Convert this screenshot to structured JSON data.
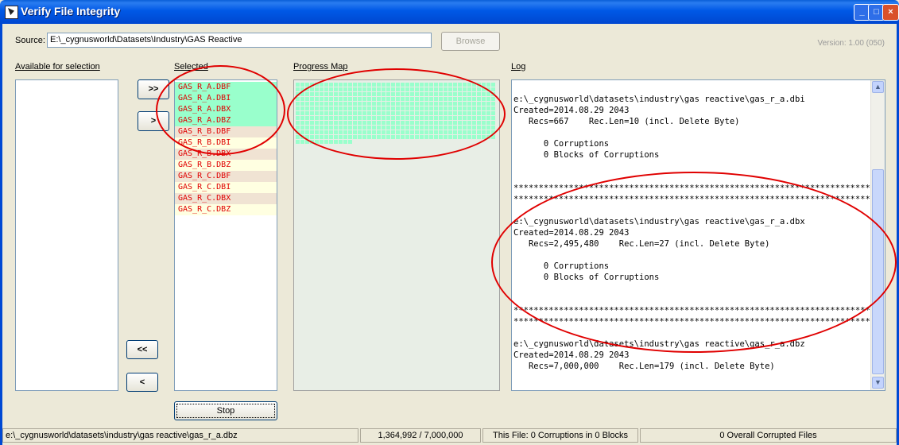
{
  "window": {
    "title": "Verify File Integrity",
    "controls": [
      "_",
      "□",
      "×"
    ]
  },
  "source": {
    "label": "Source:",
    "value": "E:\\_cygnusworld\\Datasets\\Industry\\GAS Reactive",
    "browse_label": "Browse",
    "version": "Version: 1.00 (050)"
  },
  "sections": {
    "available": "Available for selection",
    "selected": "Selected",
    "progress": "Progress Map",
    "log": "Log"
  },
  "buttons": {
    "add_all": ">>",
    "add_one": ">",
    "remove_all": "<<",
    "remove_one": "<",
    "stop": "Stop"
  },
  "selected_files": [
    {
      "name": "GAS_R_A.DBF",
      "status": "done"
    },
    {
      "name": "GAS_R_A.DBI",
      "status": "done"
    },
    {
      "name": "GAS_R_A.DBX",
      "status": "done"
    },
    {
      "name": "GAS_R_A.DBZ",
      "status": "done"
    },
    {
      "name": "GAS_R_B.DBF",
      "status": "pending"
    },
    {
      "name": "GAS_R_B.DBI",
      "status": "pending"
    },
    {
      "name": "GAS_R_B.DBX",
      "status": "pending"
    },
    {
      "name": "GAS_R_B.DBZ",
      "status": "pending"
    },
    {
      "name": "GAS_R_C.DBF",
      "status": "pending"
    },
    {
      "name": "GAS_R_C.DBI",
      "status": "pending"
    },
    {
      "name": "GAS_R_C.DBX",
      "status": "pending"
    },
    {
      "name": "GAS_R_C.DBZ",
      "status": "pending"
    }
  ],
  "progress_map": {
    "fraction": 0.195,
    "fill_color": "#99ffcc",
    "background": "#e8eee6"
  },
  "log_lines": [
    "e:\\_cygnusworld\\datasets\\industry\\gas reactive\\gas_r_a.dbi",
    "Created=2014.08.29 2043",
    "   Recs=667    Rec.Len=10 (incl. Delete Byte)",
    "",
    "      0 Corruptions",
    "      0 Blocks of Corruptions",
    "",
    "",
    "*******************************************************************************",
    "*******************************************************************************",
    "",
    "e:\\_cygnusworld\\datasets\\industry\\gas reactive\\gas_r_a.dbx",
    "Created=2014.08.29 2043",
    "   Recs=2,495,480    Rec.Len=27 (incl. Delete Byte)",
    "",
    "      0 Corruptions",
    "      0 Blocks of Corruptions",
    "",
    "",
    "*******************************************************************************",
    "*******************************************************************************",
    "",
    "e:\\_cygnusworld\\datasets\\industry\\gas reactive\\gas_r_a.dbz",
    "Created=2014.08.29 2043",
    "   Recs=7,000,000    Rec.Len=179 (incl. Delete Byte)"
  ],
  "log_scroll": {
    "up": "▲",
    "down": "▼"
  },
  "status_bar": {
    "path": "e:\\_cygnusworld\\datasets\\industry\\gas reactive\\gas_r_a.dbz",
    "records": "1,364,992 / 7,000,000",
    "this_file": "This File: 0  Corruptions in 0 Blocks",
    "overall": "0 Overall Corrupted Files"
  },
  "colors": {
    "title_bar": "#0058e6",
    "window_bg": "#ece9d8",
    "done_row": "#99ffcc",
    "file_text": "#e00000",
    "annotation": "#e00000"
  }
}
